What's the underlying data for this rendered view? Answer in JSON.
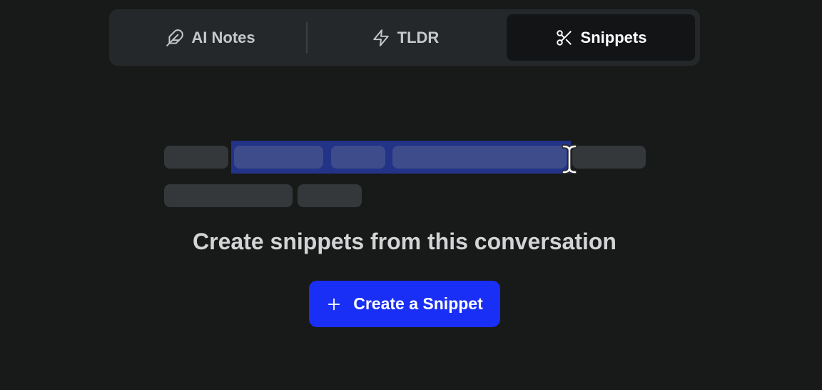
{
  "tabs": [
    {
      "label": "AI Notes",
      "icon": "feather-icon"
    },
    {
      "label": "TLDR",
      "icon": "lightning-icon"
    },
    {
      "label": "Snippets",
      "icon": "scissors-icon"
    }
  ],
  "empty_state": {
    "title": "Create snippets from this conversation",
    "button_label": "Create a Snippet",
    "button_icon": "plus-icon"
  },
  "colors": {
    "background": "#181919",
    "tab_bar": "#25282a",
    "active_tab": "#131415",
    "accent": "#1a2ff5",
    "selection": "#223388"
  }
}
